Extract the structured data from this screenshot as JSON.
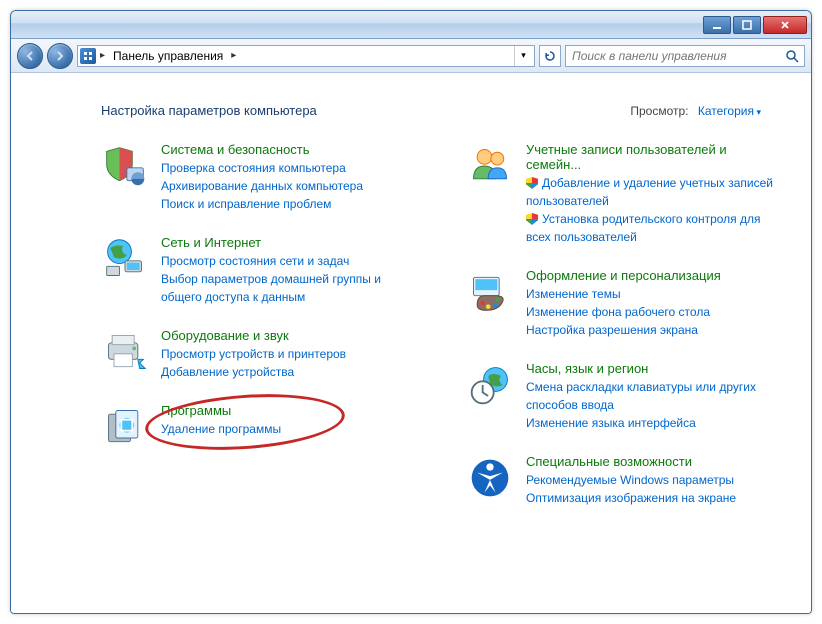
{
  "titlebar": {
    "min": "_",
    "max": "▢",
    "close": "✕"
  },
  "nav": {
    "breadcrumb_seg": "Панель управления",
    "search_placeholder": "Поиск в панели управления"
  },
  "header": {
    "title": "Настройка параметров компьютера",
    "view_label": "Просмотр:",
    "view_value": "Категория"
  },
  "left": [
    {
      "title": "Система и безопасность",
      "links": [
        {
          "t": "Проверка состояния компьютера"
        },
        {
          "t": "Архивирование данных компьютера"
        },
        {
          "t": "Поиск и исправление проблем"
        }
      ]
    },
    {
      "title": "Сеть и Интернет",
      "links": [
        {
          "t": "Просмотр состояния сети и задач"
        },
        {
          "t": "Выбор параметров домашней группы и общего доступа к данным"
        }
      ]
    },
    {
      "title": "Оборудование и звук",
      "links": [
        {
          "t": "Просмотр устройств и принтеров"
        },
        {
          "t": "Добавление устройства"
        }
      ]
    },
    {
      "title": "Программы",
      "links": [
        {
          "t": "Удаление программы"
        }
      ]
    }
  ],
  "right": [
    {
      "title": "Учетные записи пользователей и семейн...",
      "links": [
        {
          "t": "Добавление и удаление учетных записей пользователей",
          "shield": true
        },
        {
          "t": "Установка родительского контроля для всех пользователей",
          "shield": true
        }
      ]
    },
    {
      "title": "Оформление и персонализация",
      "links": [
        {
          "t": "Изменение темы"
        },
        {
          "t": "Изменение фона рабочего стола"
        },
        {
          "t": "Настройка разрешения экрана"
        }
      ]
    },
    {
      "title": "Часы, язык и регион",
      "links": [
        {
          "t": "Смена раскладки клавиатуры или других способов ввода"
        },
        {
          "t": "Изменение языка интерфейса"
        }
      ]
    },
    {
      "title": "Специальные возможности",
      "links": [
        {
          "t": "Рекомендуемые Windows параметры"
        },
        {
          "t": "Оптимизация изображения на экране"
        }
      ]
    }
  ]
}
